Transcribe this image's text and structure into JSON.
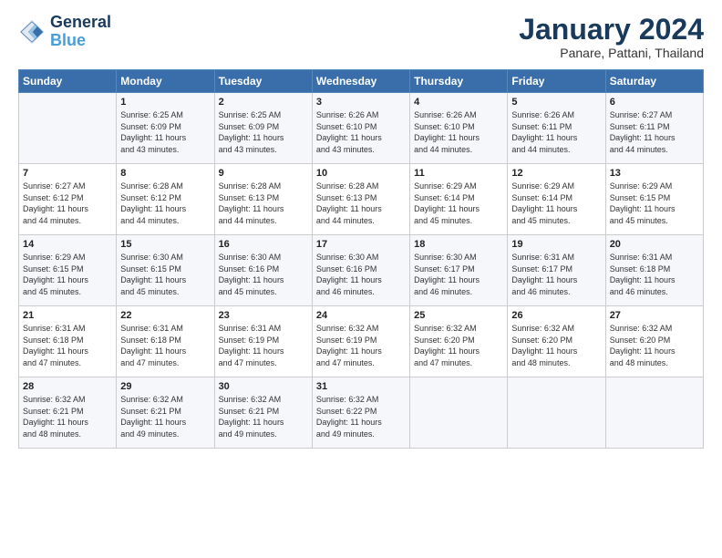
{
  "header": {
    "logo_line1": "General",
    "logo_line2": "Blue",
    "title": "January 2024",
    "subtitle": "Panare, Pattani, Thailand"
  },
  "weekdays": [
    "Sunday",
    "Monday",
    "Tuesday",
    "Wednesday",
    "Thursday",
    "Friday",
    "Saturday"
  ],
  "weeks": [
    [
      {
        "day": "",
        "info": ""
      },
      {
        "day": "1",
        "info": "Sunrise: 6:25 AM\nSunset: 6:09 PM\nDaylight: 11 hours\nand 43 minutes."
      },
      {
        "day": "2",
        "info": "Sunrise: 6:25 AM\nSunset: 6:09 PM\nDaylight: 11 hours\nand 43 minutes."
      },
      {
        "day": "3",
        "info": "Sunrise: 6:26 AM\nSunset: 6:10 PM\nDaylight: 11 hours\nand 43 minutes."
      },
      {
        "day": "4",
        "info": "Sunrise: 6:26 AM\nSunset: 6:10 PM\nDaylight: 11 hours\nand 44 minutes."
      },
      {
        "day": "5",
        "info": "Sunrise: 6:26 AM\nSunset: 6:11 PM\nDaylight: 11 hours\nand 44 minutes."
      },
      {
        "day": "6",
        "info": "Sunrise: 6:27 AM\nSunset: 6:11 PM\nDaylight: 11 hours\nand 44 minutes."
      }
    ],
    [
      {
        "day": "7",
        "info": "Sunrise: 6:27 AM\nSunset: 6:12 PM\nDaylight: 11 hours\nand 44 minutes."
      },
      {
        "day": "8",
        "info": "Sunrise: 6:28 AM\nSunset: 6:12 PM\nDaylight: 11 hours\nand 44 minutes."
      },
      {
        "day": "9",
        "info": "Sunrise: 6:28 AM\nSunset: 6:13 PM\nDaylight: 11 hours\nand 44 minutes."
      },
      {
        "day": "10",
        "info": "Sunrise: 6:28 AM\nSunset: 6:13 PM\nDaylight: 11 hours\nand 44 minutes."
      },
      {
        "day": "11",
        "info": "Sunrise: 6:29 AM\nSunset: 6:14 PM\nDaylight: 11 hours\nand 45 minutes."
      },
      {
        "day": "12",
        "info": "Sunrise: 6:29 AM\nSunset: 6:14 PM\nDaylight: 11 hours\nand 45 minutes."
      },
      {
        "day": "13",
        "info": "Sunrise: 6:29 AM\nSunset: 6:15 PM\nDaylight: 11 hours\nand 45 minutes."
      }
    ],
    [
      {
        "day": "14",
        "info": "Sunrise: 6:29 AM\nSunset: 6:15 PM\nDaylight: 11 hours\nand 45 minutes."
      },
      {
        "day": "15",
        "info": "Sunrise: 6:30 AM\nSunset: 6:15 PM\nDaylight: 11 hours\nand 45 minutes."
      },
      {
        "day": "16",
        "info": "Sunrise: 6:30 AM\nSunset: 6:16 PM\nDaylight: 11 hours\nand 45 minutes."
      },
      {
        "day": "17",
        "info": "Sunrise: 6:30 AM\nSunset: 6:16 PM\nDaylight: 11 hours\nand 46 minutes."
      },
      {
        "day": "18",
        "info": "Sunrise: 6:30 AM\nSunset: 6:17 PM\nDaylight: 11 hours\nand 46 minutes."
      },
      {
        "day": "19",
        "info": "Sunrise: 6:31 AM\nSunset: 6:17 PM\nDaylight: 11 hours\nand 46 minutes."
      },
      {
        "day": "20",
        "info": "Sunrise: 6:31 AM\nSunset: 6:18 PM\nDaylight: 11 hours\nand 46 minutes."
      }
    ],
    [
      {
        "day": "21",
        "info": "Sunrise: 6:31 AM\nSunset: 6:18 PM\nDaylight: 11 hours\nand 47 minutes."
      },
      {
        "day": "22",
        "info": "Sunrise: 6:31 AM\nSunset: 6:18 PM\nDaylight: 11 hours\nand 47 minutes."
      },
      {
        "day": "23",
        "info": "Sunrise: 6:31 AM\nSunset: 6:19 PM\nDaylight: 11 hours\nand 47 minutes."
      },
      {
        "day": "24",
        "info": "Sunrise: 6:32 AM\nSunset: 6:19 PM\nDaylight: 11 hours\nand 47 minutes."
      },
      {
        "day": "25",
        "info": "Sunrise: 6:32 AM\nSunset: 6:20 PM\nDaylight: 11 hours\nand 47 minutes."
      },
      {
        "day": "26",
        "info": "Sunrise: 6:32 AM\nSunset: 6:20 PM\nDaylight: 11 hours\nand 48 minutes."
      },
      {
        "day": "27",
        "info": "Sunrise: 6:32 AM\nSunset: 6:20 PM\nDaylight: 11 hours\nand 48 minutes."
      }
    ],
    [
      {
        "day": "28",
        "info": "Sunrise: 6:32 AM\nSunset: 6:21 PM\nDaylight: 11 hours\nand 48 minutes."
      },
      {
        "day": "29",
        "info": "Sunrise: 6:32 AM\nSunset: 6:21 PM\nDaylight: 11 hours\nand 49 minutes."
      },
      {
        "day": "30",
        "info": "Sunrise: 6:32 AM\nSunset: 6:21 PM\nDaylight: 11 hours\nand 49 minutes."
      },
      {
        "day": "31",
        "info": "Sunrise: 6:32 AM\nSunset: 6:22 PM\nDaylight: 11 hours\nand 49 minutes."
      },
      {
        "day": "",
        "info": ""
      },
      {
        "day": "",
        "info": ""
      },
      {
        "day": "",
        "info": ""
      }
    ]
  ]
}
